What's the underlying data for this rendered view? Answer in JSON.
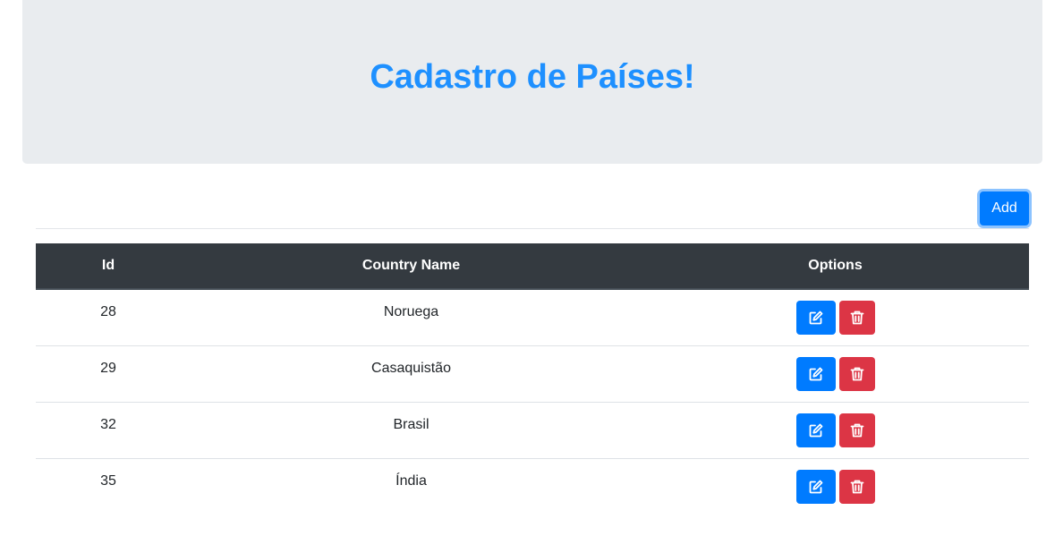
{
  "header": {
    "title": "Cadastro de Países!"
  },
  "toolbar": {
    "add_label": "Add"
  },
  "table": {
    "columns": [
      "Id",
      "Country Name",
      "Options"
    ],
    "rows": [
      {
        "id": "28",
        "name": "Noruega"
      },
      {
        "id": "29",
        "name": "Casaquistão"
      },
      {
        "id": "32",
        "name": "Brasil"
      },
      {
        "id": "35",
        "name": "Índia"
      }
    ]
  },
  "row_actions": {
    "edit_icon": "edit-icon",
    "delete_icon": "trash-icon"
  },
  "colors": {
    "title": "#1e90ff",
    "primary": "#007bff",
    "danger": "#dc3545",
    "header_bg": "#343a40",
    "jumbotron_bg": "#e9ecef"
  }
}
